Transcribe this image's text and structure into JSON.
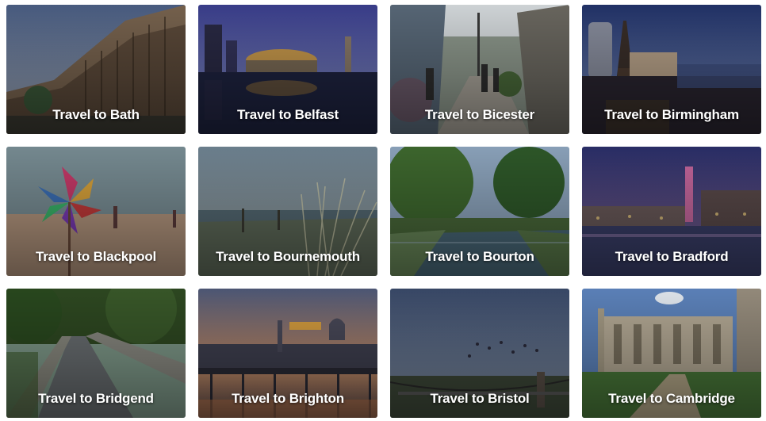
{
  "cards": [
    {
      "label": "Travel to Bath"
    },
    {
      "label": "Travel to Belfast"
    },
    {
      "label": "Travel to Bicester"
    },
    {
      "label": "Travel to Birmingham"
    },
    {
      "label": "Travel to Blackpool"
    },
    {
      "label": "Travel to Bournemouth"
    },
    {
      "label": "Travel to Bourton"
    },
    {
      "label": "Travel to Bradford"
    },
    {
      "label": "Travel to Bridgend"
    },
    {
      "label": "Travel to Brighton"
    },
    {
      "label": "Travel to Bristol"
    },
    {
      "label": "Travel to Cambridge"
    }
  ]
}
